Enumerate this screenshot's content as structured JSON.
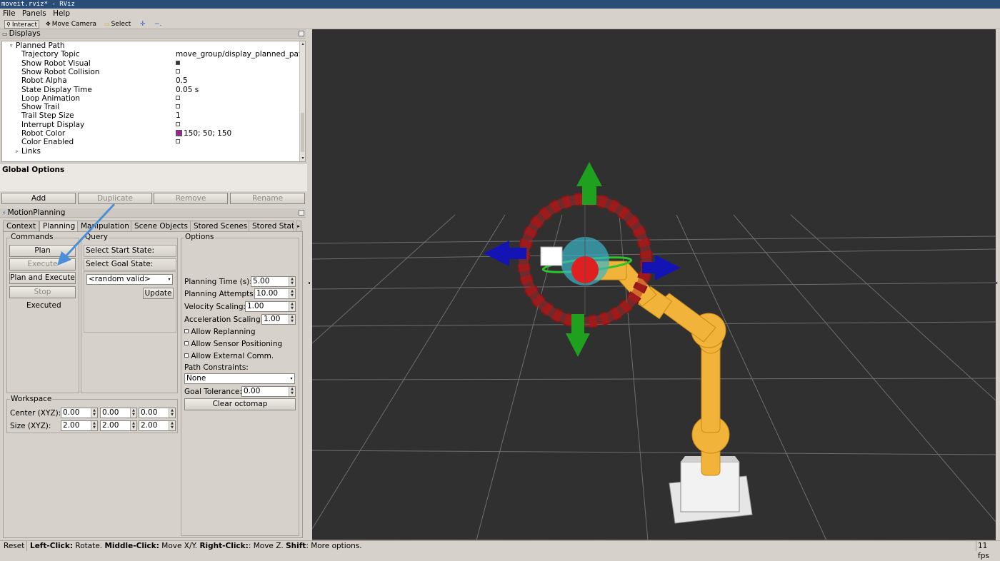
{
  "window": {
    "title": "moveit.rviz* - RViz"
  },
  "menu": {
    "items": [
      "File",
      "Panels",
      "Help"
    ]
  },
  "toolbar": {
    "tools": [
      {
        "label": "Interact",
        "icon": "interact-icon",
        "active": true
      },
      {
        "label": "Move Camera",
        "icon": "move-camera-icon",
        "active": false
      },
      {
        "label": "Select",
        "icon": "select-icon",
        "active": false
      }
    ],
    "extra_icons": [
      "plus-icon",
      "minus-icon"
    ]
  },
  "displays": {
    "header": "Displays",
    "tree": [
      {
        "key": "Planned Path",
        "value": "",
        "expander": "open"
      },
      {
        "key": "Trajectory Topic",
        "value": "move_group/display_planned_path"
      },
      {
        "key": "Show Robot Visual",
        "checkbox": true
      },
      {
        "key": "Show Robot Collision",
        "checkbox": false
      },
      {
        "key": "Robot Alpha",
        "value": "0.5"
      },
      {
        "key": "State Display Time",
        "value": "0.05 s"
      },
      {
        "key": "Loop Animation",
        "checkbox": false
      },
      {
        "key": "Show Trail",
        "checkbox": false
      },
      {
        "key": "Trail Step Size",
        "value": "1"
      },
      {
        "key": "Interrupt Display",
        "checkbox": false
      },
      {
        "key": "Robot Color",
        "value": "150; 50; 150",
        "color": "#962896"
      },
      {
        "key": "Color Enabled",
        "checkbox": false
      },
      {
        "key": "Links",
        "value": "",
        "expander": "closed"
      }
    ],
    "description_title": "Global Options",
    "buttons": {
      "add": "Add",
      "duplicate": "Duplicate",
      "remove": "Remove",
      "rename": "Rename"
    }
  },
  "motion_planning": {
    "header": "MotionPlanning",
    "tabs": [
      "Context",
      "Planning",
      "Manipulation",
      "Scene Objects",
      "Stored Scenes",
      "Stored Stat"
    ],
    "active_tab": "Planning",
    "commands": {
      "title": "Commands",
      "plan": "Plan",
      "execute": "Execute",
      "plan_and_execute": "Plan and Execute",
      "stop": "Stop",
      "status": "Executed"
    },
    "query": {
      "title": "Query",
      "start_state": "Select Start State:",
      "goal_state": "Select Goal State:",
      "goal_value": "<random valid>",
      "update": "Update"
    },
    "options": {
      "title": "Options",
      "planning_time_label": "Planning Time (s):",
      "planning_time": "5.00",
      "planning_attempts_label": "Planning Attempts:",
      "planning_attempts": "10.00",
      "velocity_label": "Velocity Scaling:",
      "velocity": "1.00",
      "accel_label": "Acceleration Scaling:",
      "accel": "1.00",
      "allow_replanning": "Allow Replanning",
      "allow_sensor": "Allow Sensor Positioning",
      "allow_external": "Allow External Comm.",
      "path_constraints_label": "Path Constraints:",
      "path_constraints": "None",
      "goal_tolerance_label": "Goal Tolerance:",
      "goal_tolerance": "0.00",
      "clear_octomap": "Clear octomap"
    },
    "workspace": {
      "title": "Workspace",
      "center_label": "Center (XYZ):",
      "center": [
        "0.00",
        "0.00",
        "0.00"
      ],
      "size_label": "Size (XYZ):",
      "size": [
        "2.00",
        "2.00",
        "2.00"
      ]
    }
  },
  "statusbar": {
    "reset": "Reset",
    "hint_parts": [
      {
        "text": "Left-Click:",
        "bold": true
      },
      {
        "text": " Rotate. ",
        "bold": false
      },
      {
        "text": "Middle-Click:",
        "bold": true
      },
      {
        "text": " Move X/Y. ",
        "bold": false
      },
      {
        "text": "Right-Click:",
        "bold": true
      },
      {
        "text": ": Move Z. ",
        "bold": false
      },
      {
        "text": "Shift",
        "bold": true
      },
      {
        "text": ": More options.",
        "bold": false
      }
    ],
    "fps": "11 fps"
  },
  "colors": {
    "viewport_bg": "#303030",
    "grid": "#6e6e6e",
    "robot": "#f2b33a",
    "ring": "#8a1515",
    "arrow_green": "#1fa01f",
    "arrow_blue": "#1414b4",
    "annotation_arrow": "#4a8fd8"
  }
}
